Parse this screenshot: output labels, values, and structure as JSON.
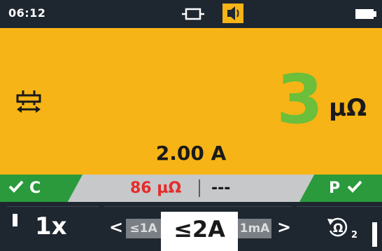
{
  "status_bar": {
    "time": "06:12",
    "icons": [
      "continuity-mode-icon",
      "buzzer-on-icon",
      "battery-icon"
    ]
  },
  "display": {
    "mode_icon": "continuity-arrows-icon",
    "main_value": "3",
    "main_unit": "µΩ",
    "test_current": "2.00 A",
    "main_color": "#f7b416",
    "value_color": "#6bbf3a"
  },
  "result_strip": {
    "left_badge": {
      "letter": "C",
      "icon": "checkmark-icon"
    },
    "right_badge": {
      "letter": "P",
      "icon": "checkmark-icon"
    },
    "reading_1": "86 µΩ",
    "reading_2": "---",
    "pass_color": "#2a9a3c",
    "alert_color": "#e52b2b"
  },
  "softkeys": {
    "multiplier": "1x",
    "range_selector": {
      "prev_arrow": "<",
      "next_arrow": ">",
      "prev_option": "≤1A",
      "selected": "≤2A",
      "next_option": "1mA"
    },
    "null_button": {
      "icon": "null-ohm-icon",
      "subscript": "2"
    }
  }
}
